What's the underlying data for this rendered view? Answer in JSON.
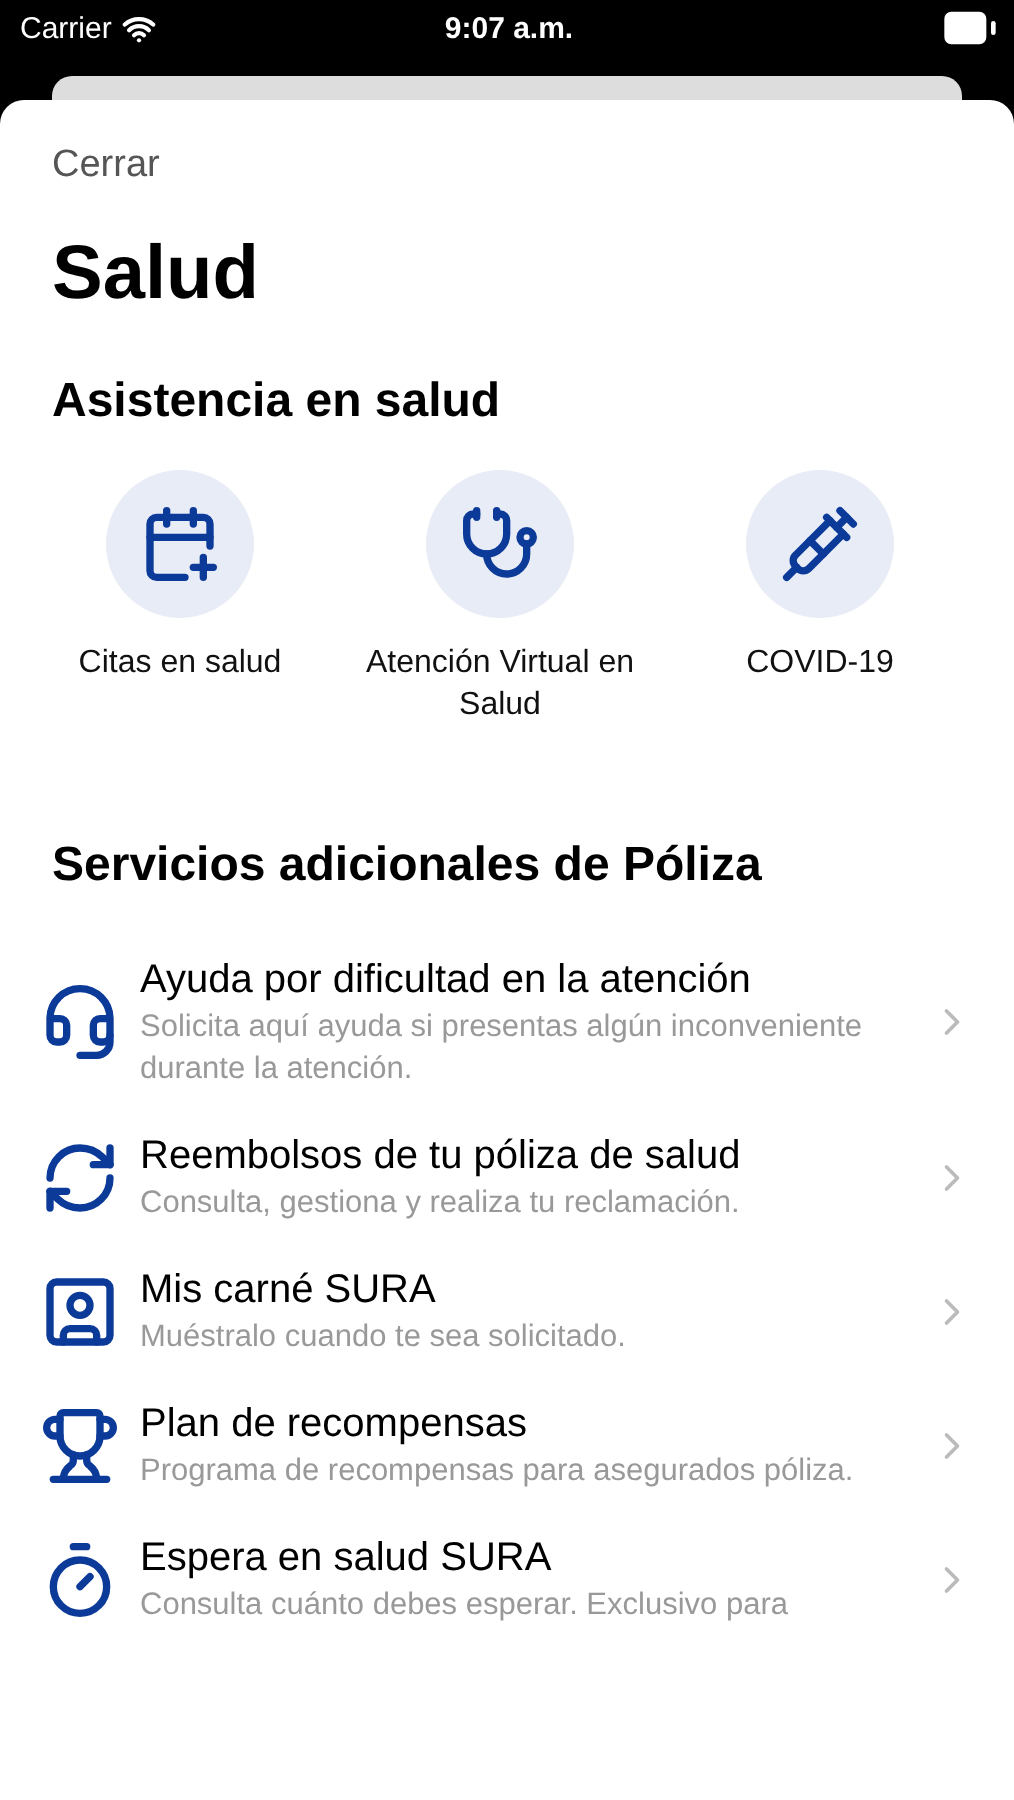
{
  "status_bar": {
    "carrier": "Carrier",
    "time": "9:07 a.m."
  },
  "close_button": "Cerrar",
  "title": "Salud",
  "health_assistance": {
    "heading": "Asistencia en salud",
    "items": [
      {
        "kind": "calendar",
        "label": "Citas en salud"
      },
      {
        "kind": "stethoscope",
        "label": "Atención Virtual en Salud"
      },
      {
        "kind": "vaccine",
        "label": "COVID-19"
      }
    ]
  },
  "policy_services": {
    "heading": "Servicios adicionales de Póliza",
    "items": [
      {
        "kind": "headset",
        "title": "Ayuda por dificultad en la atención",
        "subtitle": "Solicita aquí ayuda si presentas algún inconveniente durante la atención."
      },
      {
        "kind": "refresh",
        "title": "Reembolsos de tu póliza de salud",
        "subtitle": "Consulta, gestiona y realiza tu reclamación."
      },
      {
        "kind": "id_card",
        "title": "Mis carné SURA",
        "subtitle": "Muéstralo cuando te sea solicitado."
      },
      {
        "kind": "trophy",
        "title": "Plan de recompensas",
        "subtitle": "Programa de recompensas para asegurados póliza."
      },
      {
        "kind": "timer",
        "title": "Espera en salud SURA",
        "subtitle": "Consulta cuánto debes esperar. Exclusivo para"
      }
    ]
  }
}
